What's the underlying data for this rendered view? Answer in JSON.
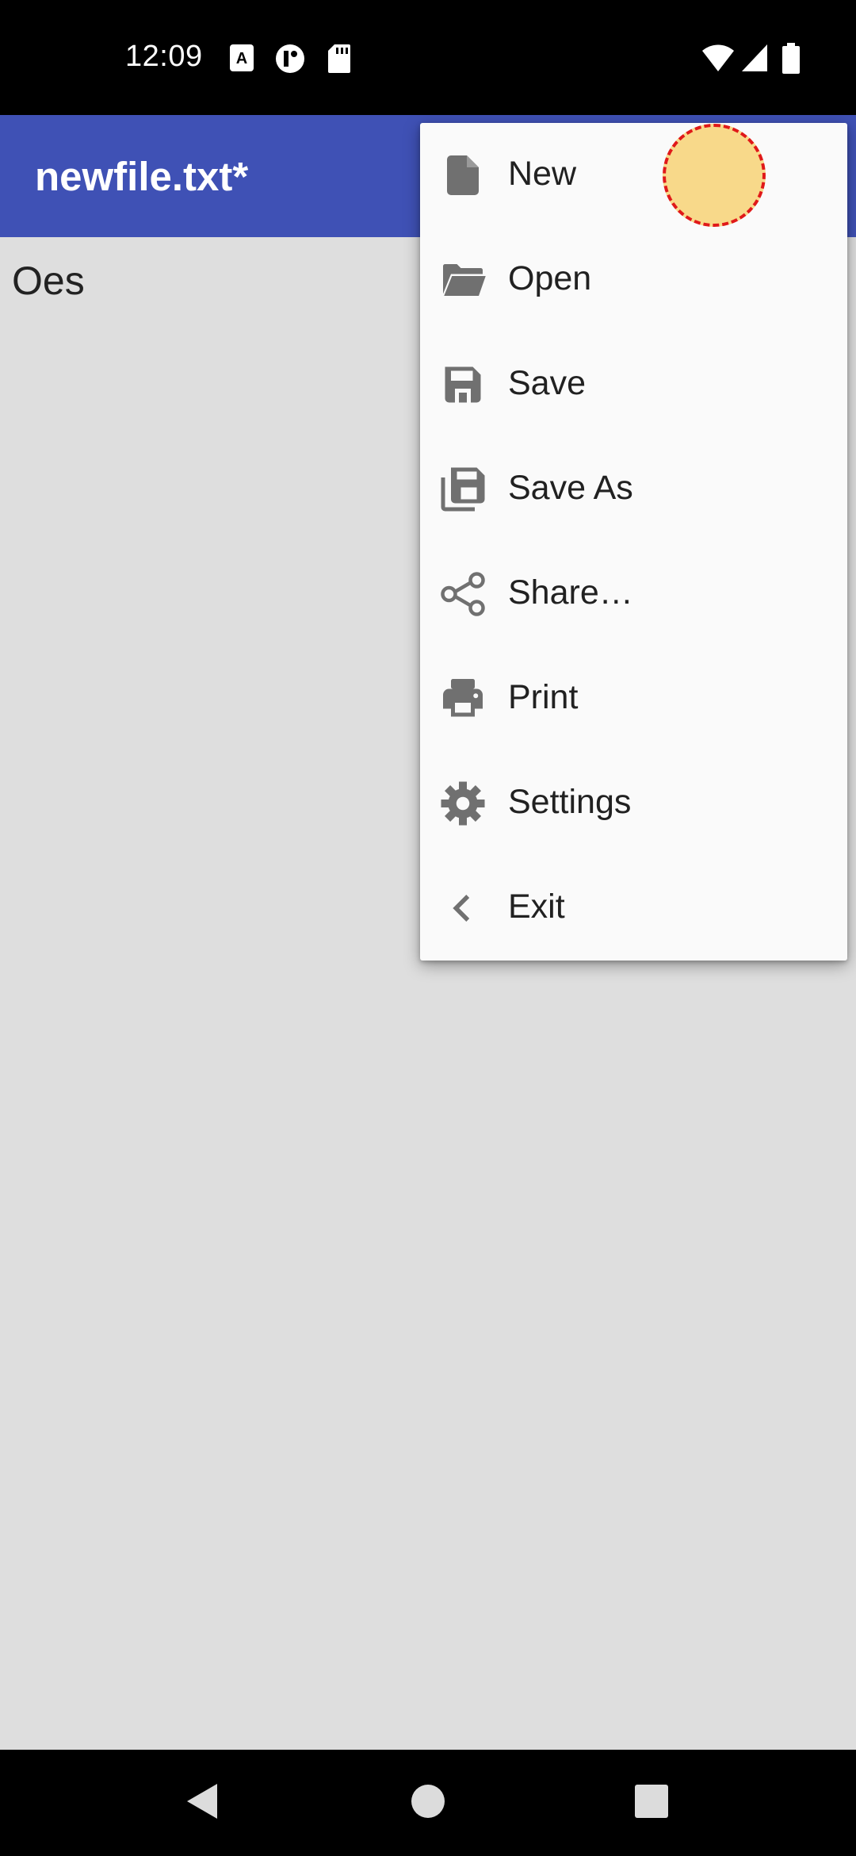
{
  "status_bar": {
    "time": "12:09",
    "left_icons": [
      "translate-icon",
      "app-notification-icon",
      "sd-card-icon"
    ],
    "right_icons": [
      "wifi-icon",
      "cell-signal-icon",
      "battery-icon"
    ]
  },
  "app_bar": {
    "title": "newfile.txt*"
  },
  "editor": {
    "content": "Oes"
  },
  "menu": {
    "items": [
      {
        "label": "New",
        "icon": "new-file-icon"
      },
      {
        "label": "Open",
        "icon": "folder-open-icon"
      },
      {
        "label": "Save",
        "icon": "save-icon"
      },
      {
        "label": "Save As",
        "icon": "save-as-icon"
      },
      {
        "label": "Share…",
        "icon": "share-icon"
      },
      {
        "label": "Print",
        "icon": "print-icon"
      },
      {
        "label": "Settings",
        "icon": "gear-icon"
      },
      {
        "label": "Exit",
        "icon": "chevron-left-icon"
      }
    ]
  },
  "nav_bar": {
    "buttons": [
      "back-icon",
      "home-icon",
      "recents-icon"
    ]
  },
  "colors": {
    "app_bar": "#3f51b5",
    "background": "#dedede",
    "menu": "#fafafa",
    "icon": "#707070"
  }
}
